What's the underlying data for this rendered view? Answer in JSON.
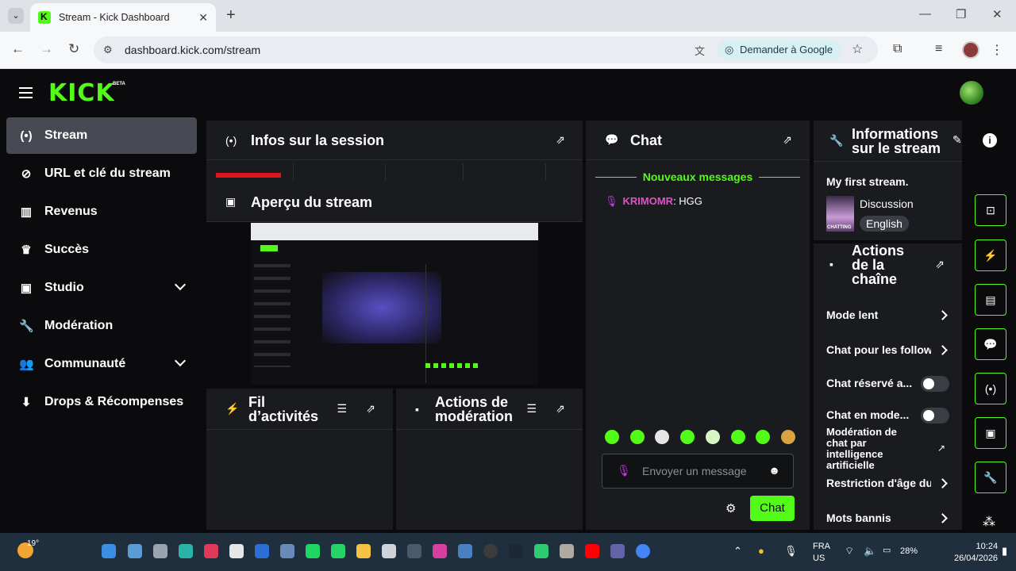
{
  "browser": {
    "tab_title": "Stream - Kick Dashboard",
    "url": "dashboard.kick.com/stream",
    "ask_google": "Demander à Google"
  },
  "app": {
    "logo": "KICK",
    "beta": "BETA"
  },
  "sidebar": {
    "items": [
      {
        "label": "Stream",
        "icon": "stream-icon"
      },
      {
        "label": "URL et clé du stream",
        "icon": "link-icon"
      },
      {
        "label": "Revenus",
        "icon": "chart-icon"
      },
      {
        "label": "Succès",
        "icon": "trophy-icon"
      },
      {
        "label": "Studio",
        "icon": "studio-icon"
      },
      {
        "label": "Modération",
        "icon": "wrench-icon"
      },
      {
        "label": "Communauté",
        "icon": "community-icon"
      },
      {
        "label": "Drops & Récompenses",
        "icon": "drops-icon"
      }
    ]
  },
  "panels": {
    "session": {
      "title": "Infos sur la session"
    },
    "preview": {
      "title": "Aperçu du stream"
    },
    "activity": {
      "title_line1": "Fil",
      "title_line2": "d’activités"
    },
    "mod_actions": {
      "title_line1": "Actions de",
      "title_line2": "modération"
    },
    "chat": {
      "title": "Chat",
      "new_messages": "Nouveaux messages",
      "messages": [
        {
          "user": "KRIMOMR",
          "text": "HGG"
        }
      ],
      "input_placeholder": "Envoyer un message",
      "send_label": "Chat"
    },
    "stream_info": {
      "title_line1": "Informations",
      "title_line2": "sur le stream",
      "stream_title": "My first stream.",
      "category": "Discussion",
      "thumb_text": "CHATTING",
      "language": "English"
    },
    "channel_actions": {
      "title_line1": "Actions",
      "title_line2": "de la",
      "title_line3": "chaîne",
      "items": [
        {
          "label": "Mode lent",
          "control": "chevron"
        },
        {
          "label": "Chat pour les follow",
          "control": "chevron"
        },
        {
          "label": "Chat réservé a...",
          "control": "toggle"
        },
        {
          "label": "Chat en mode...",
          "control": "toggle"
        },
        {
          "label_lines": [
            "Modération de",
            "chat par",
            "intelligence",
            "artificielle"
          ],
          "control": "external"
        },
        {
          "label": "Restriction d'âge du",
          "control": "chevron"
        },
        {
          "label": "Mots bannis",
          "control": "chevron"
        }
      ]
    }
  },
  "taskbar": {
    "temperature": "19°",
    "lang_line1": "FRA",
    "lang_line2": "US",
    "battery": "28%",
    "time": "10:24",
    "date": "26/04/2026"
  },
  "colors": {
    "accent": "#53fc18",
    "panel": "#191b1f",
    "background": "#0b0b0d",
    "username": "#e052c8"
  }
}
